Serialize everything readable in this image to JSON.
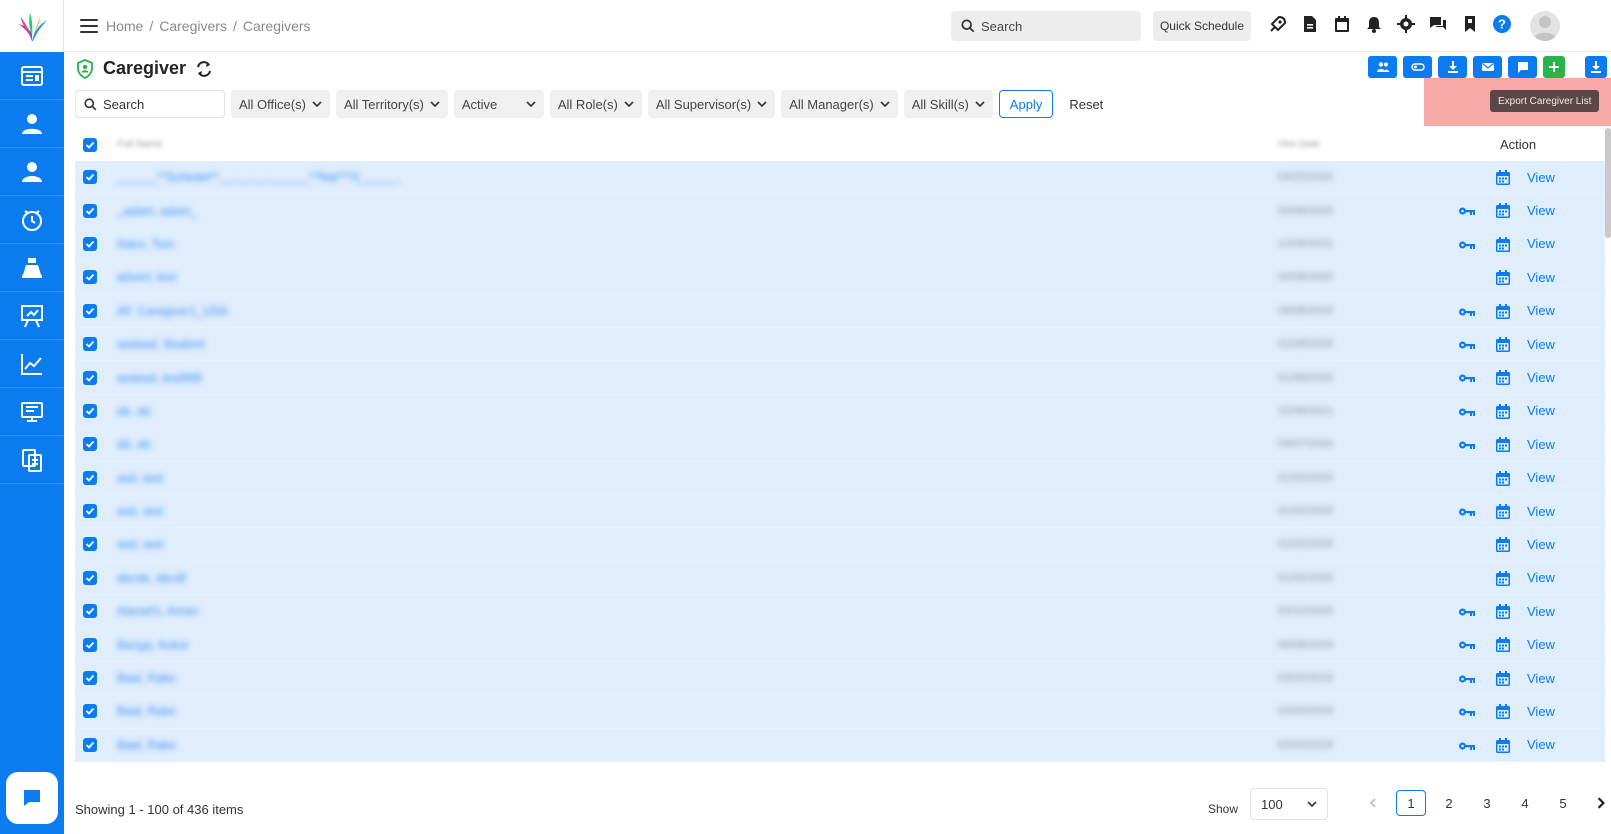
{
  "breadcrumb": [
    "Home",
    "Caregivers",
    "Caregivers"
  ],
  "topbar": {
    "search_placeholder": "Search",
    "quick_schedule": "Quick Schedule"
  },
  "page": {
    "title": "Caregiver"
  },
  "tooltip": "Export Caregiver List",
  "filters": {
    "search_placeholder": "Search",
    "selects": [
      "All Office(s)",
      "All Territory(s)",
      "Active",
      "All Role(s)",
      "All Supervisor(s)",
      "All Manager(s)",
      "All Skill(s)"
    ],
    "apply": "Apply",
    "reset": "Reset"
  },
  "table": {
    "header_name": "Full Name",
    "header_hire": "Hire Date",
    "header_action": "Action",
    "view_label": "View",
    "rows": [
      {
        "name": "______**Schedel**__,__,__,______**Nat***X______",
        "hire": "04/25/2020",
        "key": false
      },
      {
        "name": "_adam, adam_",
        "hire": "04/08/2020",
        "key": true
      },
      {
        "name": "Aden, Tom",
        "hire": "12/08/2021",
        "key": true
      },
      {
        "name": "advert, test",
        "hire": "02/08/2020",
        "key": false
      },
      {
        "name": "AF, Caregiver1_USA",
        "hire": "09/08/2015",
        "key": true
      },
      {
        "name": "aadasd, Student",
        "hire": "01/08/2020",
        "key": true
      },
      {
        "name": "asdasd, test999",
        "hire": "01/08/2020",
        "key": true
      },
      {
        "name": "ab, ab",
        "hire": "12/08/2021",
        "key": true
      },
      {
        "name": "ab, ab",
        "hire": "03/07/2020",
        "key": true
      },
      {
        "name": "asd, asd",
        "hire": "01/02/2020",
        "key": false
      },
      {
        "name": "asd, asd",
        "hire": "01/02/2020",
        "key": true
      },
      {
        "name": "asd, asd",
        "hire": "01/02/2020",
        "key": false
      },
      {
        "name": "abcde, abcdf",
        "hire": "01/02/2020",
        "key": false
      },
      {
        "name": "Alana01, Aman",
        "hire": "03/10/2020",
        "key": true
      },
      {
        "name": "Banga, Ankur",
        "hire": "08/08/2019",
        "key": true
      },
      {
        "name": "Baal, Rake",
        "hire": "03/20/2019",
        "key": true
      },
      {
        "name": "Baal, Rake",
        "hire": "03/20/2019",
        "key": true
      },
      {
        "name": "Baal, Rake",
        "hire": "03/20/2019",
        "key": true
      }
    ]
  },
  "footer": {
    "showing": "Showing 1 - 100 of 436 items",
    "show_label": "Show",
    "page_size": "100",
    "pages": [
      "1",
      "2",
      "3",
      "4",
      "5"
    ],
    "current_page": "1"
  }
}
